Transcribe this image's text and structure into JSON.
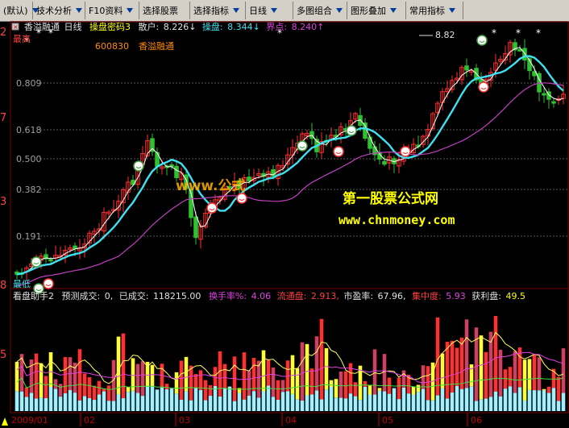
{
  "toolbar": {
    "items": [
      {
        "label": "(默认)",
        "dropdown": true
      },
      {
        "label": "技术分析",
        "dropdown": true
      },
      {
        "label": "F10资料",
        "dropdown": true
      },
      {
        "label": "选择股票",
        "dropdown": false
      },
      {
        "label": "选择指标",
        "dropdown": true
      },
      {
        "label": "日线",
        "dropdown": true
      },
      {
        "label": "多图组合",
        "dropdown": true
      },
      {
        "label": "图形叠加",
        "dropdown": true
      },
      {
        "label": "常用指标",
        "dropdown": true
      }
    ]
  },
  "main_panel": {
    "stock_name": "香溢融通",
    "period": "日线",
    "indicator": "操盘密码3",
    "retail_label": "散户:",
    "retail_value": "8.226↓",
    "operator_label": "操盘:",
    "operator_value": "8.344↓",
    "boundary_label": "界点:",
    "boundary_value": "8.240↑",
    "code": "600830",
    "code_name": "香溢融通",
    "high_label": "最高",
    "low_label": "最低",
    "peak_price": "8.82",
    "y_ticks": [
      "0.809",
      "0.618",
      "0.500",
      "0.382",
      "0.191"
    ],
    "left_edge_digits": [
      "2",
      "7",
      "3",
      "8"
    ],
    "watermark_cn": "第一股票公式网",
    "watermark_url": "www.chnmoney.com",
    "overlay_text": "www.公式"
  },
  "volume_panel": {
    "indicator": "看盘助手2",
    "forecast_label": "预测成交:",
    "forecast_value": "0,",
    "done_label": "已成交:",
    "done_value": "118215.00",
    "turnover_label": "换手率%:",
    "turnover_value": "4.06",
    "float_label": "流通盘:",
    "float_value": "2.913,",
    "pe_label": "市盈率:",
    "pe_value": "67.96,",
    "conc_label": "集中度:",
    "conc_value": "5.93",
    "profit_label": "获利盘:",
    "profit_value": "49.5",
    "left_edge_digit": "5"
  },
  "date_axis": {
    "labels": [
      "2009/01",
      "02",
      "03",
      "04",
      "05",
      "06"
    ]
  },
  "colors": {
    "up": "#ff3030",
    "down": "#30c030",
    "ma_fast": "#40e0f0",
    "ma_slow": "#c040c0",
    "grid": "#7a0000",
    "watermark": "#ffff00",
    "label_red": "#ff4040"
  }
}
